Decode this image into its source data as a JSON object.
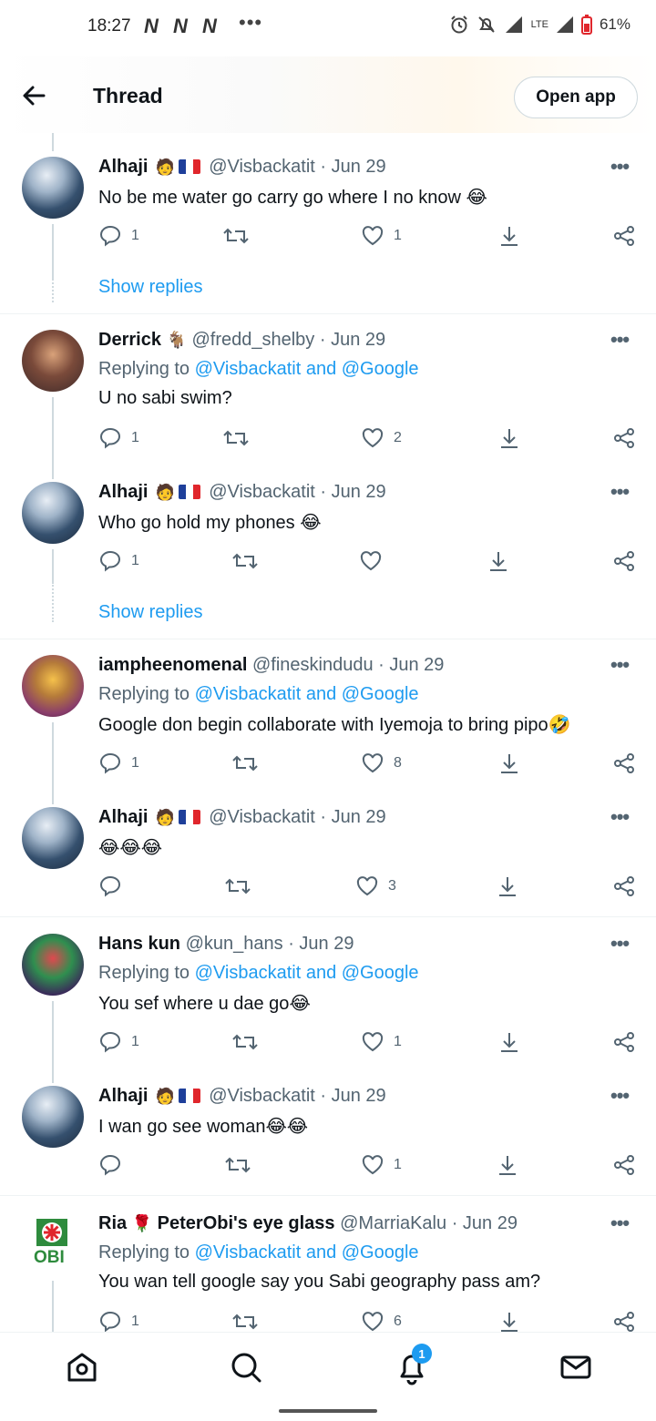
{
  "status_bar": {
    "time": "18:27",
    "n_icons": [
      "N",
      "N",
      "N"
    ],
    "more": "•••",
    "battery": "61%",
    "network": "LTE"
  },
  "header": {
    "title": "Thread",
    "open_app": "Open app"
  },
  "tweets": [
    {
      "name": "Alhaji",
      "handle": "@Visbackatit",
      "date": "· Jun 29",
      "text": "No be me water go carry go where I no know",
      "emoji": "😂",
      "replies": "1",
      "likes": "1",
      "show_replies": "Show replies",
      "avatar": "alhaji"
    },
    {
      "name": "Derrick",
      "handle": "@fredd_shelby",
      "date": "· Jun 29",
      "replying_prefix": "Replying to",
      "replying_to": "@Visbackatit and @Google",
      "text": "U no sabi swim?",
      "replies": "1",
      "likes": "2",
      "avatar": "derrick"
    },
    {
      "name": "Alhaji",
      "handle": "@Visbackatit",
      "date": "· Jun 29",
      "text": "Who go hold my phones",
      "emoji": "😂",
      "replies": "1",
      "likes": "",
      "show_replies": "Show replies",
      "avatar": "alhaji"
    },
    {
      "name": "iampheenomenal",
      "handle": "@fineskindudu",
      "date": "· Jun 29",
      "replying_prefix": "Replying to",
      "replying_to": "@Visbackatit and @Google",
      "text": "Google don begin collaborate with Iyemoja to bring pipo",
      "emoji": "🤣",
      "replies": "1",
      "likes": "8",
      "avatar": "iamphee"
    },
    {
      "name": "Alhaji",
      "handle": "@Visbackatit",
      "date": "· Jun 29",
      "text": "",
      "emoji": "😂😂😂",
      "replies": "",
      "likes": "3",
      "avatar": "alhaji"
    },
    {
      "name": "Hans kun",
      "handle": "@kun_hans",
      "date": "· Jun 29",
      "replying_prefix": "Replying to",
      "replying_to": "@Visbackatit and @Google",
      "text": "You sef where u dae go",
      "emoji": "😂",
      "replies": "1",
      "likes": "1",
      "avatar": "hans"
    },
    {
      "name": "Alhaji",
      "handle": "@Visbackatit",
      "date": "· Jun 29",
      "text": "I wan go see woman",
      "emoji": "😂😂",
      "replies": "",
      "likes": "1",
      "avatar": "alhaji"
    },
    {
      "name": "Ria",
      "name_suffix": "PeterObi's eye glass",
      "handle": "@MarriaKalu",
      "date": "· Jun 29",
      "replying_prefix": "Replying to",
      "replying_to": "@Visbackatit and @Google",
      "text": "You wan tell google say you Sabi geography pass am?",
      "replies": "1",
      "likes": "6",
      "avatar": "ria",
      "avatar_text": "OBI"
    }
  ],
  "nav": {
    "notifications_badge": "1"
  },
  "colors": {
    "link": "#1d9bf0",
    "muted": "#536471",
    "text": "#0f1419"
  }
}
